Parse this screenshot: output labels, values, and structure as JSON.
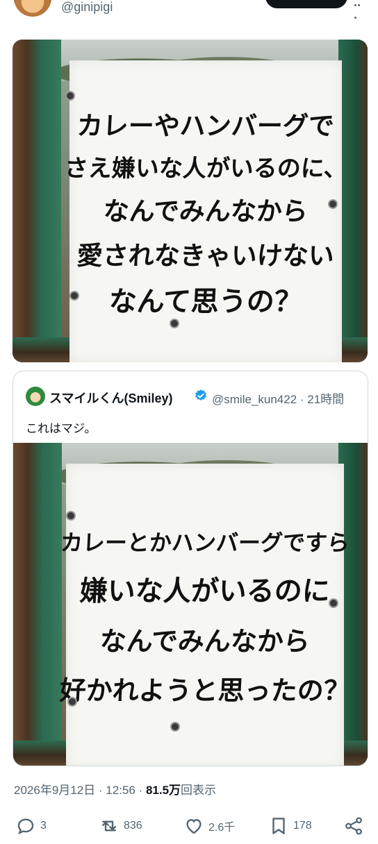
{
  "author": {
    "handle": "@ginipigi"
  },
  "main_photo": {
    "lines": [
      "カレーやハンバーグで",
      "さえ嫌いな人がいるのに、",
      "なんでみんなから",
      "愛されなきゃいけない",
      "なんて思うの？"
    ]
  },
  "quoted": {
    "name": "スマイルくん(Smiley)",
    "handle_time": "@smile_kun422 · 21時間",
    "text": "これはマジ。",
    "photo_lines": [
      "カレーとかハンバーグですら",
      "嫌いな人がいるのに",
      "なんでみんなから",
      "好かれようと思ったの？"
    ]
  },
  "meta": {
    "date": "2026年9月12日 · 12:56 · ",
    "views": "81.5万",
    "views_label": "回表示"
  },
  "actions": {
    "reply_count": "3",
    "retweet_count": "836",
    "like_count": "2.6千",
    "bookmark_count": "178"
  },
  "colors": {
    "verified": "#1d9bf0",
    "muted": "#536471"
  }
}
